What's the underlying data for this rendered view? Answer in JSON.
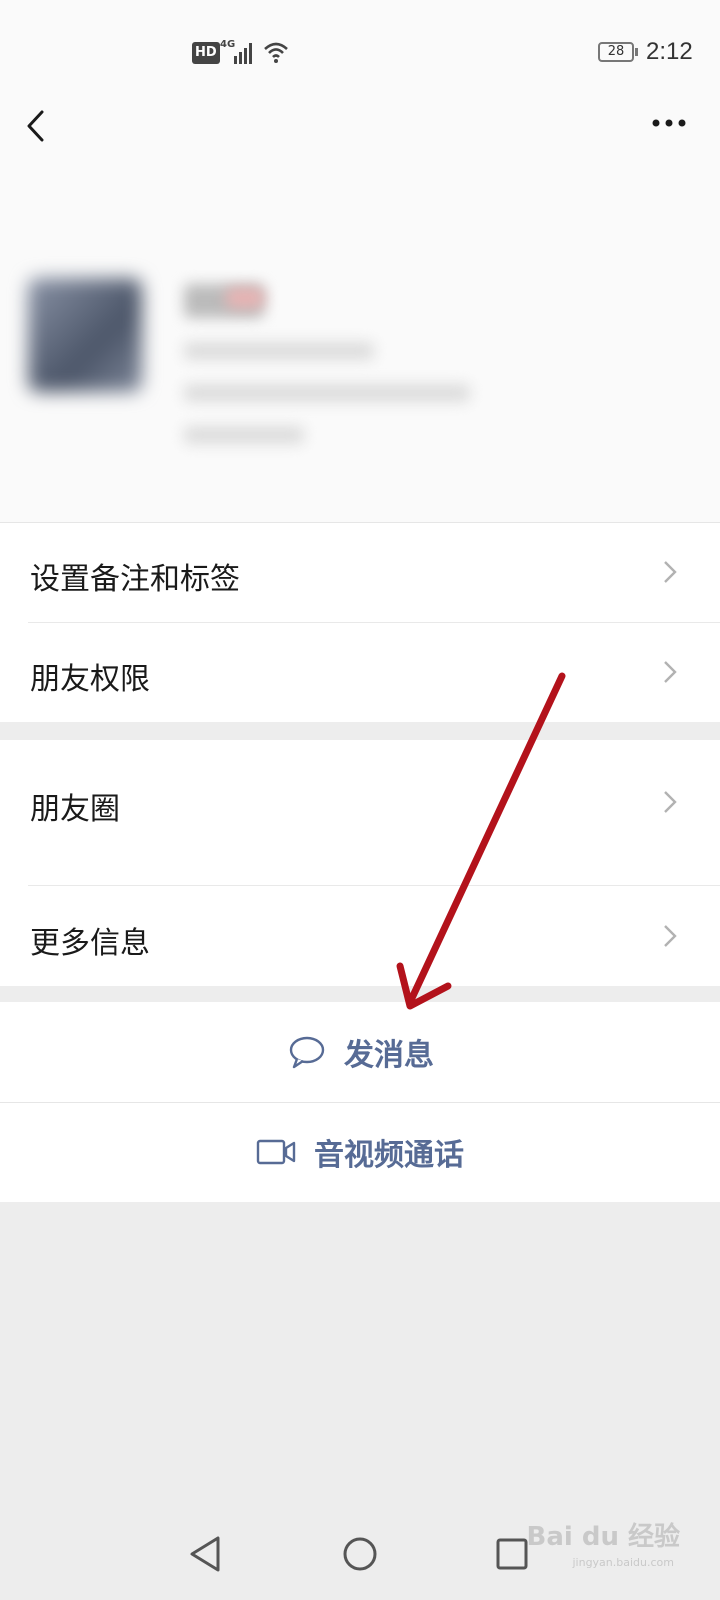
{
  "status_bar": {
    "hd": "HD",
    "network": "4G",
    "battery": "28",
    "time": "2:12"
  },
  "header": {
    "back_icon": "chevron-left-icon",
    "more_icon": "more-dots-icon"
  },
  "menu_group_1": [
    {
      "label": "设置备注和标签",
      "icon": "chevron-right-icon"
    },
    {
      "label": "朋友权限",
      "icon": "chevron-right-icon"
    }
  ],
  "menu_group_2": [
    {
      "label": "朋友圈",
      "icon": "chevron-right-icon"
    },
    {
      "label": "更多信息",
      "icon": "chevron-right-icon"
    }
  ],
  "actions": {
    "send_message": {
      "label": "发消息",
      "icon": "chat-bubble-icon"
    },
    "video_call": {
      "label": "音视频通话",
      "icon": "video-camera-icon"
    }
  },
  "colors": {
    "accent": "#576b95",
    "annotation_arrow": "#b3121b",
    "background": "#ededed"
  },
  "watermark": {
    "brand": "Bai du 经验",
    "url": "jingyan.baidu.com"
  }
}
